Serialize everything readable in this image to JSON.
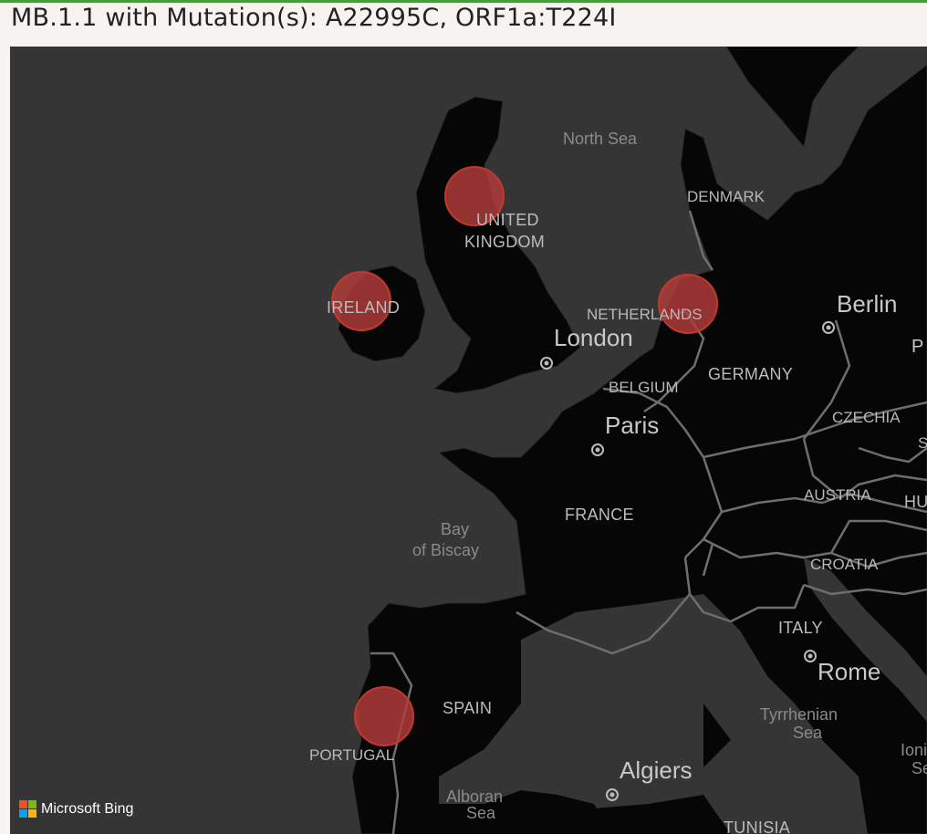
{
  "title": "MB.1.1 with Mutation(s): A22995C, ORF1a:T224I",
  "map": {
    "attribution": "Microsoft Bing",
    "colors": {
      "sea": "#353535",
      "land": "#060606",
      "border": "#6e6e6e",
      "marker_fill": "#b33a3a",
      "marker_stroke": "#c0392b",
      "header_accent": "#4a9a3c"
    },
    "labels": {
      "north_sea": "North Sea",
      "denmark": "DENMARK",
      "united_kingdom_1": "UNITED",
      "united_kingdom_2": "KINGDOM",
      "ireland": "IRELAND",
      "netherlands": "NETHERLANDS",
      "berlin": "Berlin",
      "london": "London",
      "belgium": "BELGIUM",
      "germany": "GERMANY",
      "paris": "Paris",
      "czechia": "CZECHIA",
      "austria": "AUSTRIA",
      "hu_partial": "HU",
      "po_partial": "P",
      "s_partial": "S",
      "bay_of_biscay_1": "Bay",
      "bay_of_biscay_2": "of Biscay",
      "france": "FRANCE",
      "croatia": "CROATIA",
      "italy": "ITALY",
      "rome": "Rome",
      "spain": "SPAIN",
      "portugal": "PORTUGAL",
      "tyrrhenian_1": "Tyrrhenian",
      "tyrrhenian_2": "Sea",
      "ionian_1": "Ioni",
      "ionian_2": "Se",
      "algiers": "Algiers",
      "alboran_1": "Alboran",
      "alboran_2": "Sea",
      "tunisia": "TUNISIA"
    },
    "markers": [
      {
        "location": "United Kingdom"
      },
      {
        "location": "Ireland"
      },
      {
        "location": "Netherlands"
      },
      {
        "location": "Portugal"
      }
    ]
  }
}
